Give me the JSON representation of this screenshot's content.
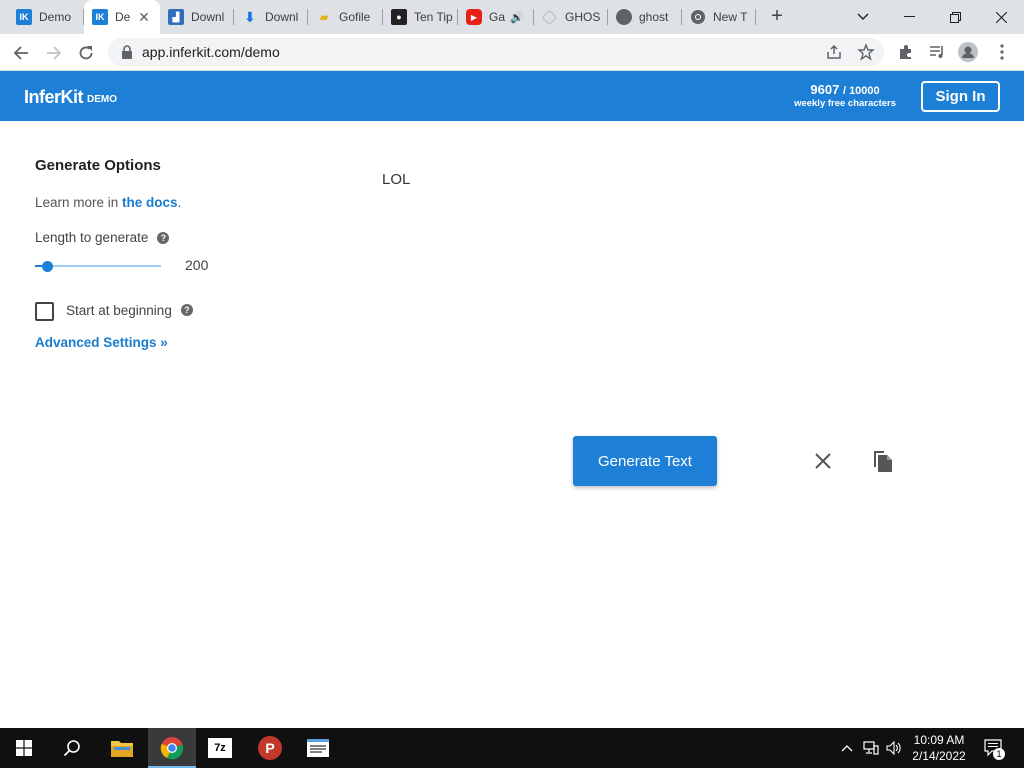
{
  "browser": {
    "tabs": [
      {
        "title": "Demo",
        "favicon": "inferkit-favicon"
      },
      {
        "title": "De",
        "favicon": "inferkit-favicon",
        "active": true
      },
      {
        "title": "Downl",
        "favicon": "chart-favicon"
      },
      {
        "title": "Downl",
        "favicon": "download-favicon"
      },
      {
        "title": "Gofile",
        "favicon": "folder-favicon"
      },
      {
        "title": "Ten Tip",
        "favicon": "camera-favicon"
      },
      {
        "title": "Ga",
        "favicon": "youtube-favicon"
      },
      {
        "title": "GHOS",
        "favicon": "ghost-favicon"
      },
      {
        "title": "ghost",
        "favicon": "globe-favicon"
      },
      {
        "title": "New T",
        "favicon": "chrome-favicon"
      }
    ],
    "url": "app.inferkit.com/demo"
  },
  "header": {
    "brand": "InferKit",
    "brand_tag": "DEMO",
    "quota_used": "9607",
    "quota_total": "/ 10000",
    "quota_label": "weekly free characters",
    "sign_in": "Sign In"
  },
  "options": {
    "title": "Generate Options",
    "learn_prefix": "Learn more in ",
    "docs_link": "the docs",
    "learn_suffix": ".",
    "length_label": "Length to generate",
    "length_value": "200",
    "length_fraction": 0.06,
    "start_label": "Start at beginning",
    "advanced": "Advanced Settings »"
  },
  "prompt_text": "LOL",
  "actions": {
    "generate": "Generate Text"
  },
  "taskbar": {
    "time": "10:09 AM",
    "date": "2/14/2022",
    "notifications": "1"
  },
  "colors": {
    "brand_blue": "#1e7fd6",
    "link_blue": "#1a7bd0",
    "taskbar": "#101010"
  }
}
